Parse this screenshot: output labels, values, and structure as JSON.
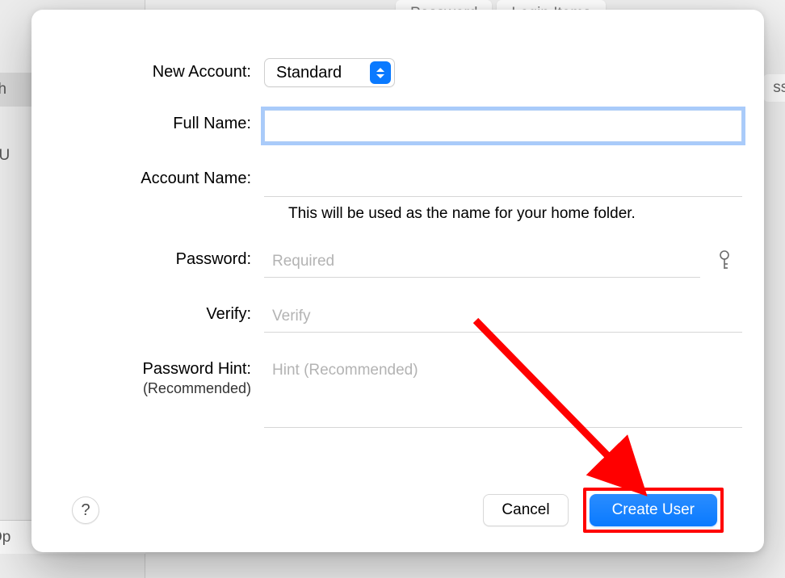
{
  "background": {
    "tabs": [
      "Password",
      "Login Items"
    ],
    "sidebar_item_1": "sh",
    "sidebar_item_2": "t U",
    "bottom_label": "Op",
    "right_button": "ssw"
  },
  "modal": {
    "account_type": {
      "label": "New Account:",
      "selected": "Standard"
    },
    "full_name": {
      "label": "Full Name:",
      "value": ""
    },
    "account_name": {
      "label": "Account Name:",
      "value": "",
      "helper": "This will be used as the name for your home folder."
    },
    "password": {
      "label": "Password:",
      "placeholder": "Required",
      "value": ""
    },
    "verify": {
      "label": "Verify:",
      "placeholder": "Verify",
      "value": ""
    },
    "hint": {
      "label": "Password Hint:",
      "sublabel": "(Recommended)",
      "placeholder": "Hint (Recommended)",
      "value": ""
    },
    "footer": {
      "help": "?",
      "cancel": "Cancel",
      "create": "Create User"
    }
  },
  "annotation": {
    "highlight_color": "#ff0000"
  }
}
